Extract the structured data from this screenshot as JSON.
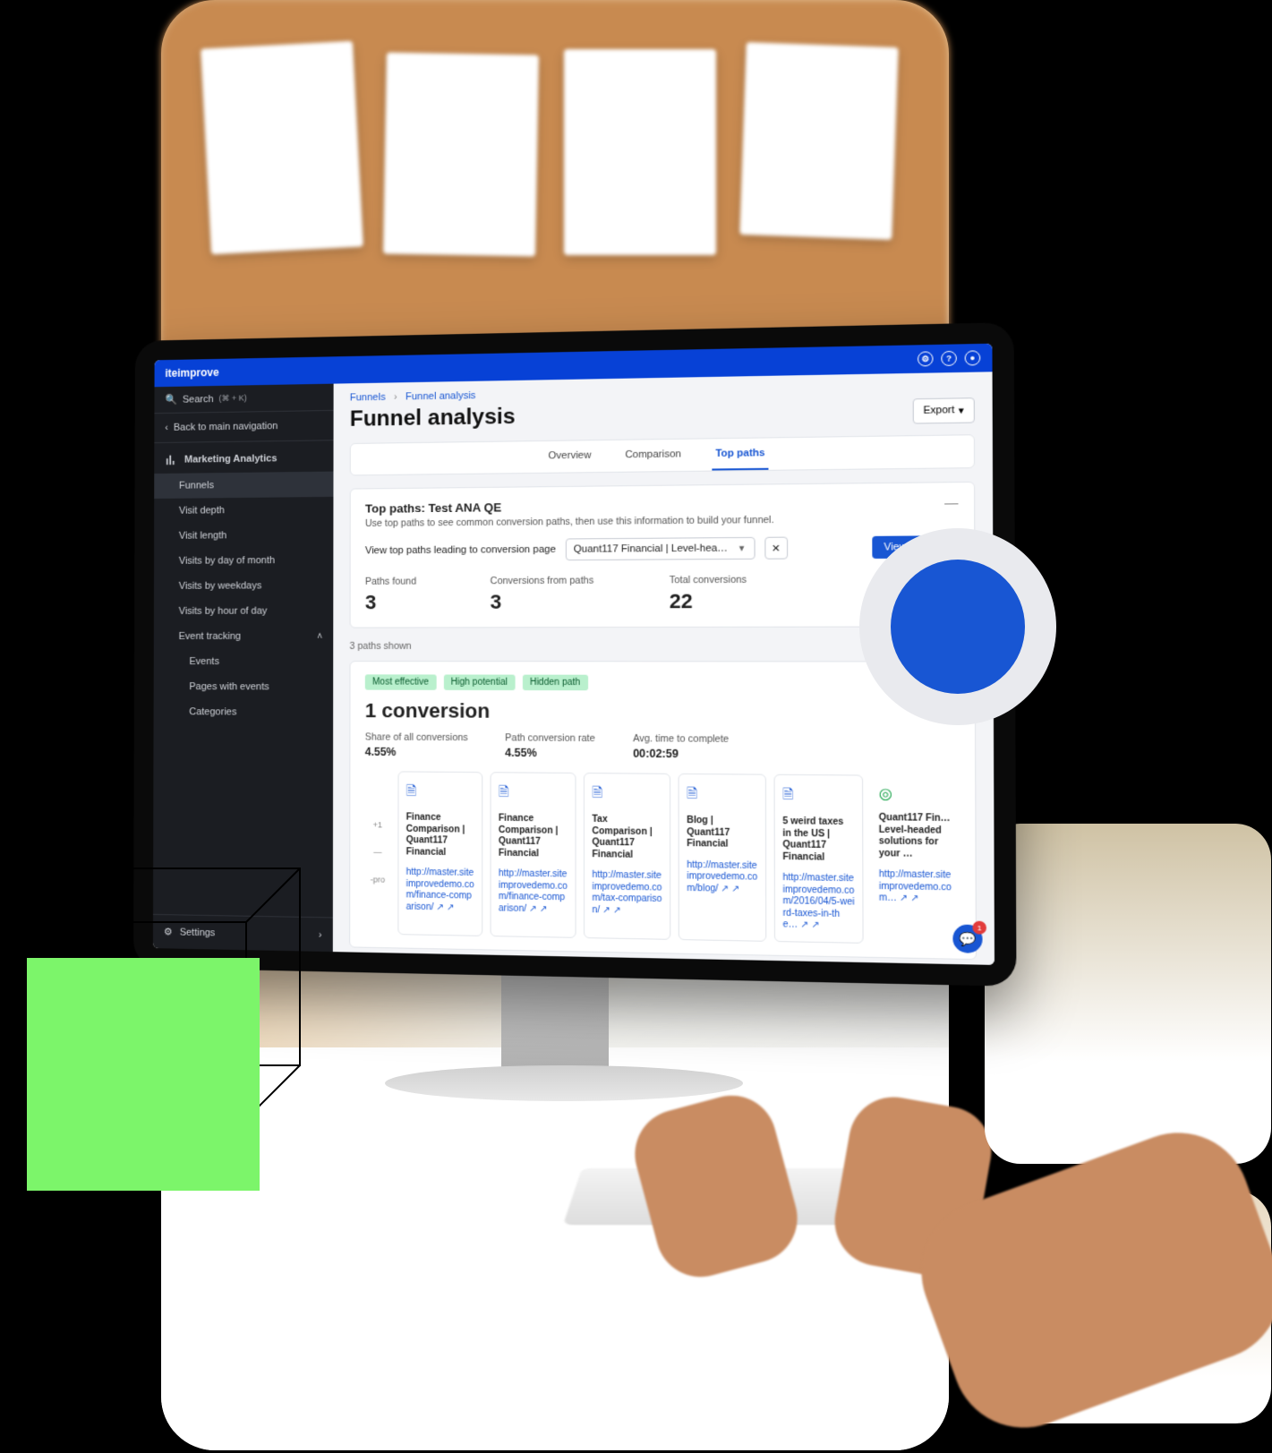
{
  "brand": "iteimprove",
  "titlebar_icons": [
    "settings",
    "help",
    "user"
  ],
  "sidebar": {
    "search_label": "Search",
    "search_shortcut": "(⌘ + K)",
    "back_label": "Back to main navigation",
    "section_label": "Marketing Analytics",
    "items": [
      {
        "label": "Funnels",
        "active": true
      },
      {
        "label": "Visit depth"
      },
      {
        "label": "Visit length"
      },
      {
        "label": "Visits by day of month"
      },
      {
        "label": "Visits by weekdays"
      },
      {
        "label": "Visits by hour of day"
      },
      {
        "label": "Event tracking",
        "expandable": true,
        "expanded": true
      },
      {
        "label": "Events",
        "sub": true
      },
      {
        "label": "Pages with events",
        "sub": true
      },
      {
        "label": "Categories",
        "sub": true
      }
    ],
    "settings_label": "Settings"
  },
  "breadcrumbs": [
    "Funnels",
    "Funnel analysis"
  ],
  "page_title": "Funnel analysis",
  "export_label": "Export",
  "tabs": [
    {
      "label": "Overview"
    },
    {
      "label": "Comparison"
    },
    {
      "label": "Top paths",
      "active": true
    }
  ],
  "top_paths": {
    "heading": "Top paths: Test ANA QE",
    "subheading": "Use top paths to see common conversion paths, then use this information to build your funnel.",
    "filter_label": "View top paths leading to conversion page",
    "filter_value": "Quant117 Financial | Level-hea…",
    "view_insights_label": "View insights",
    "stats": [
      {
        "label": "Paths found",
        "value": "3"
      },
      {
        "label": "Conversions from paths",
        "value": "3"
      },
      {
        "label": "Total conversions",
        "value": "22"
      }
    ]
  },
  "paths_shown_label": "3 paths shown",
  "conversion_card": {
    "badges": [
      "Most effective",
      "High potential",
      "Hidden path"
    ],
    "title": "1 conversion",
    "metrics": [
      {
        "label": "Share of all conversions",
        "value": "4.55%"
      },
      {
        "label": "Path conversion rate",
        "value": "4.55%"
      },
      {
        "label": "Avg. time to complete",
        "value": "00:02:59"
      }
    ],
    "left_stub_top": "+1",
    "left_stub_bottom": "-pro",
    "cards": [
      {
        "title": "Finance Comparison | Quant117 Financial",
        "url": "http://master.siteimprovedemo.com/finance-comparison/ ↗"
      },
      {
        "title": "Finance Comparison | Quant117 Financial",
        "url": "http://master.siteimprovedemo.com/finance-comparison/ ↗"
      },
      {
        "title": "Tax Comparison | Quant117 Financial",
        "url": "http://master.siteimprovedemo.com/tax-comparison/ ↗"
      },
      {
        "title": "Blog | Quant117 Financial",
        "url": "http://master.siteimprovedemo.com/blog/ ↗"
      },
      {
        "title": "5 weird taxes in the US | Quant117 Financial",
        "url": "http://master.siteimprovedemo.com/2016/04/5-weird-taxes-in-the… ↗"
      },
      {
        "title": "Quant117 Fin… Level-headed solutions for your …",
        "url": "http://master.siteimprovedemo.com… ↗",
        "goal": true
      }
    ]
  },
  "fab_badge": "1",
  "colors": {
    "accent": "#1856d3",
    "badge_bg": "#b9f0cd",
    "green_square": "#7cf56a"
  }
}
